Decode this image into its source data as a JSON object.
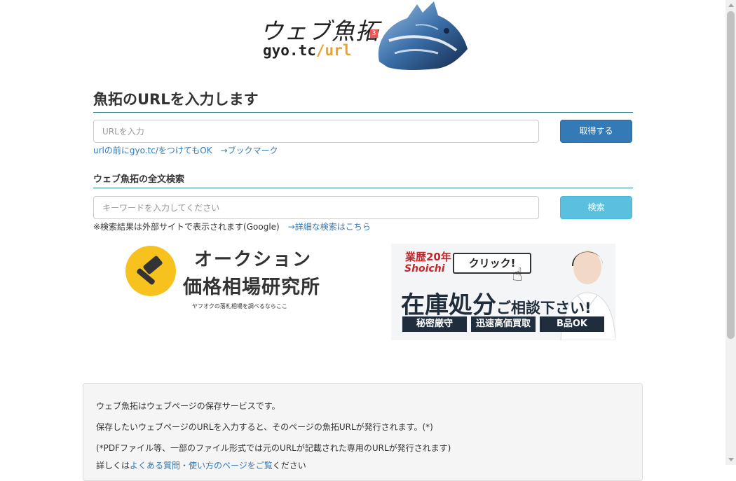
{
  "logo": {
    "jp_text": "ウェブ魚拓",
    "badge": "3",
    "domain": "gyo.tc",
    "path": "/url"
  },
  "form_url": {
    "title": "魚拓のURLを入力します",
    "placeholder": "URLを入力",
    "button_label": "取得する",
    "hint_text": "urlの前にgyo.tc/をつけてもOK",
    "hint_link": "→ブックマーク"
  },
  "form_search": {
    "title": "ウェブ魚拓の全文検索",
    "placeholder": "キーワードを入力してください",
    "button_label": "検索",
    "hint_text": "※検索結果は外部サイトで表示されます(Google)",
    "hint_link": "→詳細な検索はこちら"
  },
  "auction_banner": {
    "line1": "オークション",
    "line2": "価格相場研究所",
    "subtitle": "ヤフオクの落札相場を調べるならここ"
  },
  "ad_banner": {
    "years": "業歴20年",
    "brand": "Shoichi",
    "click": "クリック!",
    "main": "在庫処分",
    "main_small": "ご相談下さい!",
    "tags": [
      "秘密厳守",
      "迅速高価買取",
      "B品OK"
    ]
  },
  "info_panel": {
    "line1": "ウェブ魚拓はウェブページの保存サービスです。",
    "line2": "保存したいウェブページのURLを入力すると、そのページの魚拓URLが発行されます。(*)",
    "line3": "(*PDFファイル等、一部のファイル形式では元のURLが記載された専用のURLが発行されます)",
    "line4_prefix": "詳しくは",
    "line4_link": "よくある質問・使い方のページをご覧",
    "line4_suffix": "ください"
  },
  "colors": {
    "primary": "#337ab7",
    "info": "#5bc0de",
    "rule": "#2f7c8f"
  }
}
